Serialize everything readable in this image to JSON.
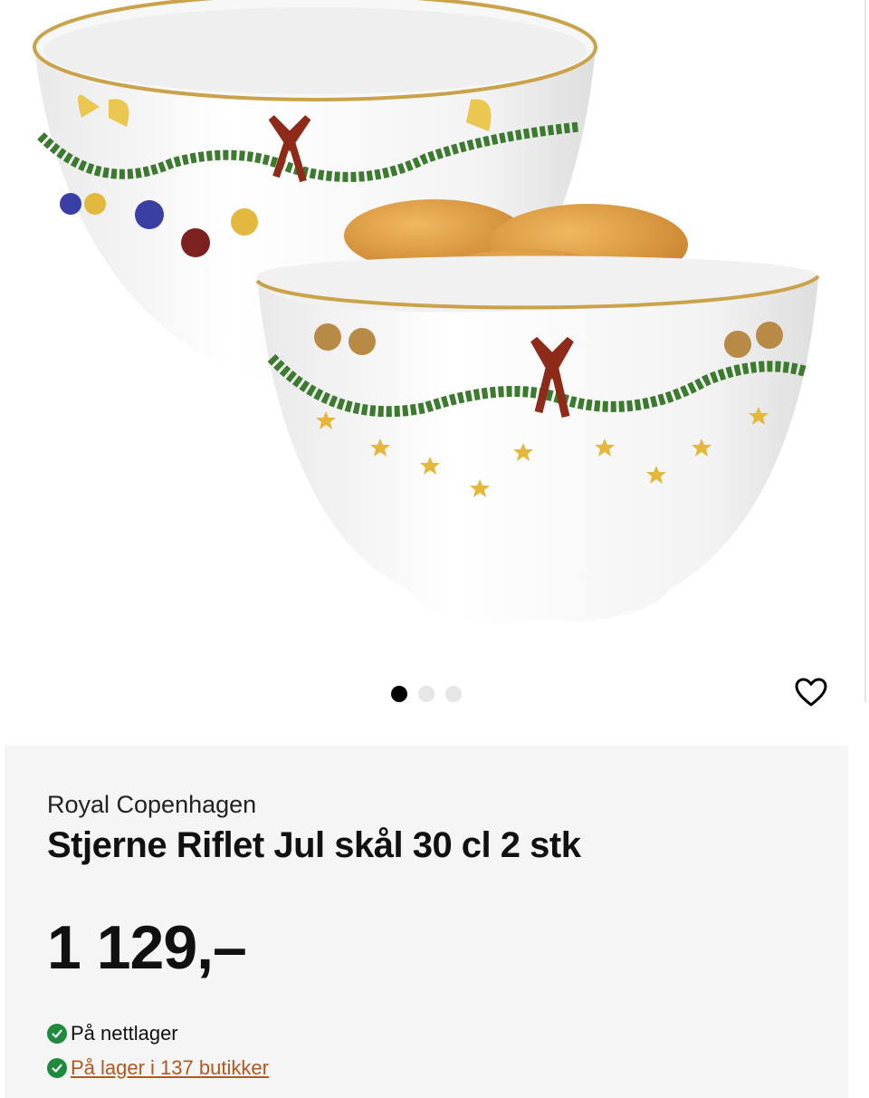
{
  "gallery": {
    "image_alt": "Royal Copenhagen Stjerne Riflet Jul skål 30 cl 2 stk",
    "slides_total": 3,
    "active_slide": 1
  },
  "product": {
    "brand": "Royal Copenhagen",
    "name": "Stjerne Riflet Jul skål 30 cl 2 stk",
    "price": "1 129,–"
  },
  "stock": {
    "online": "På nettlager",
    "stores": "På lager i 137 butikker"
  },
  "icons": {
    "favorite": "heart-outline-icon",
    "check": "check-circle-icon"
  },
  "colors": {
    "stock_ok": "#1f8a3c",
    "link": "#b4561d",
    "panel_bg": "#f5f5f5"
  }
}
